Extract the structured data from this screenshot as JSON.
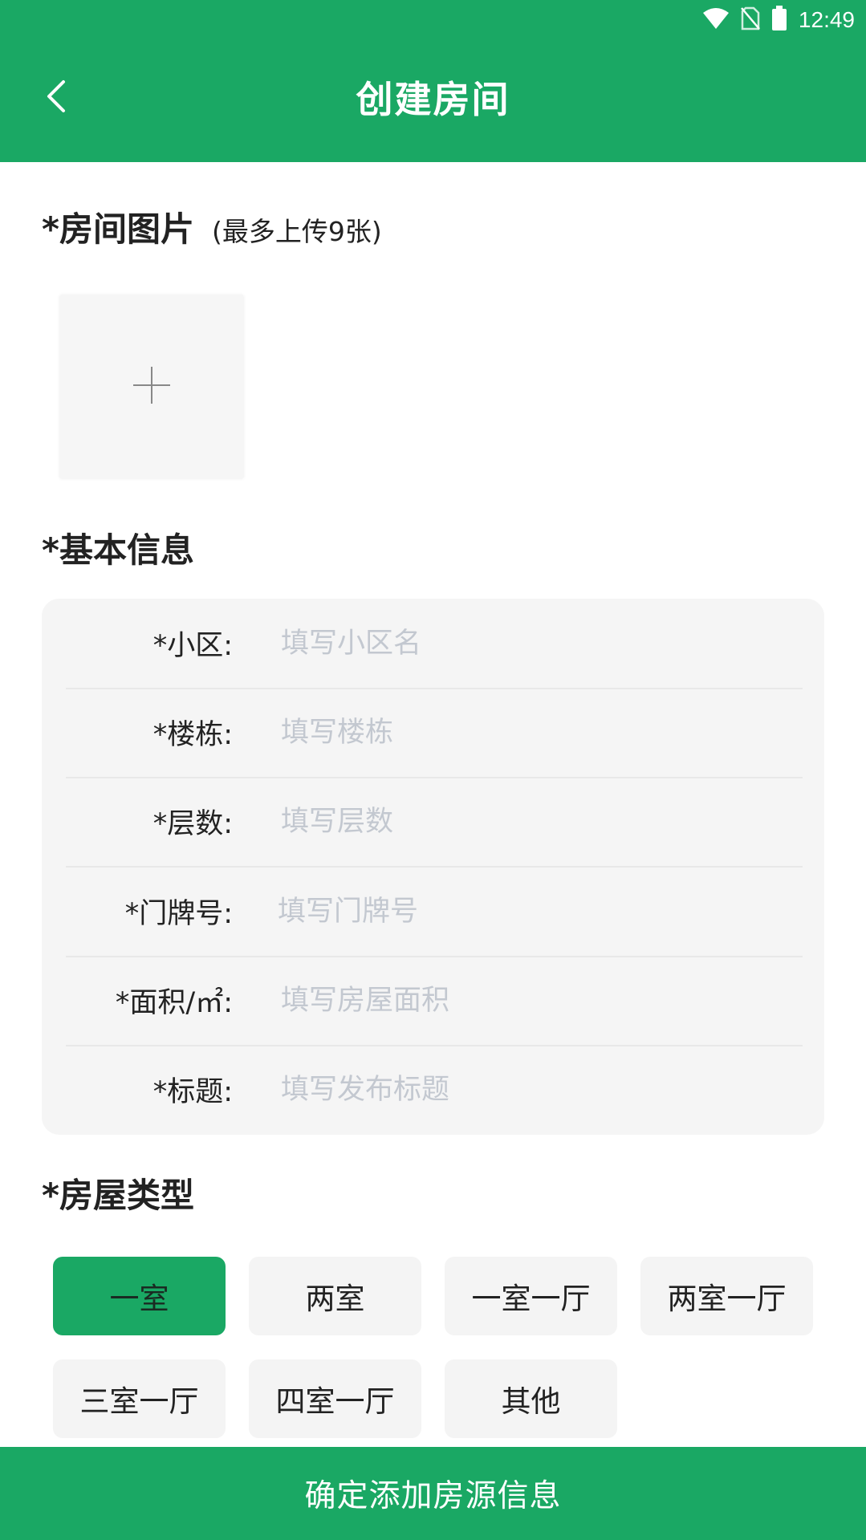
{
  "status_bar": {
    "time": "12:49",
    "icons": [
      "wifi-icon",
      "no-sim-icon",
      "battery-icon"
    ]
  },
  "header": {
    "title": "创建房间",
    "back_icon": "chevron-left-icon"
  },
  "photos": {
    "title": "*房间图片",
    "subtitle": "(最多上传9张)",
    "add_icon": "plus-icon"
  },
  "basic": {
    "title": "*基本信息",
    "fields": [
      {
        "label": "*小区:",
        "placeholder": "填写小区名",
        "value": ""
      },
      {
        "label": "*楼栋:",
        "placeholder": "填写楼栋",
        "value": ""
      },
      {
        "label": "*层数:",
        "placeholder": "填写层数",
        "value": ""
      },
      {
        "label": "*门牌号:",
        "placeholder": "填写门牌号",
        "value": ""
      },
      {
        "label": "*面积/㎡:",
        "placeholder": "填写房屋面积",
        "value": ""
      },
      {
        "label": "*标题:",
        "placeholder": "填写发布标题",
        "value": ""
      }
    ]
  },
  "house_type": {
    "title": "*房屋类型",
    "options": [
      "一室",
      "两室",
      "一室一厅",
      "两室一厅",
      "三室一厅",
      "四室一厅",
      "其他"
    ],
    "selected": "一室"
  },
  "submit": {
    "label": "确定添加房源信息"
  },
  "colors": {
    "primary": "#1aa864",
    "card_bg": "#f5f5f5",
    "placeholder": "#c3c8d0"
  }
}
